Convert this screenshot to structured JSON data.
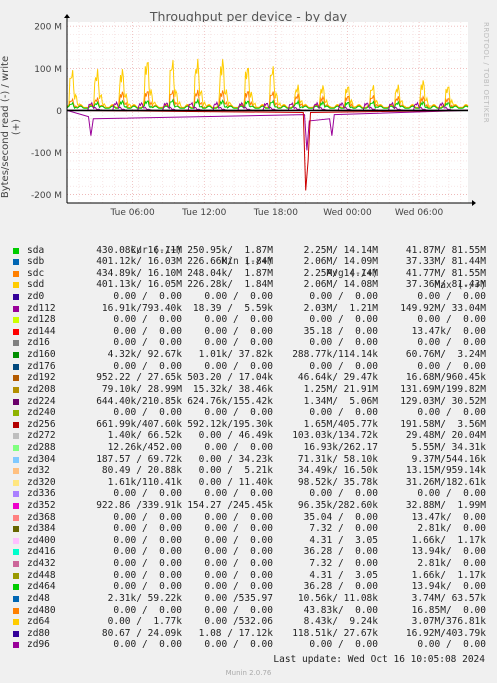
{
  "title": "Throughput per device - by day",
  "ylabel": "Bytes/second read (-) / write (+)",
  "watermark": "RRDTOOL / TOBI OETIKER",
  "chart_data": {
    "type": "line",
    "title": "Throughput per device - by day",
    "ylabel": "Bytes/second read (-) / write (+)",
    "ylim": [
      -220,
      210
    ],
    "y_ticks": [
      {
        "value": 200,
        "label": "200 M"
      },
      {
        "value": 100,
        "label": "100 M"
      },
      {
        "value": 0,
        "label": "0"
      },
      {
        "value": -100,
        "label": "-100 M"
      },
      {
        "value": -200,
        "label": "-200 M"
      }
    ],
    "x_range_hours": [
      0,
      33.6
    ],
    "x_ticks": [
      {
        "hour": 5.5,
        "label": "Tue 06:00"
      },
      {
        "hour": 11.5,
        "label": "Tue 12:00"
      },
      {
        "hour": 17.5,
        "label": "Tue 18:00"
      },
      {
        "hour": 23.5,
        "label": "Wed 00:00"
      },
      {
        "hour": 29.5,
        "label": "Wed 06:00"
      }
    ],
    "grid": true,
    "series": [
      {
        "name": "sdd",
        "color": "#ffcc00",
        "kind": "spike",
        "peaks": [
          0.2,
          2.3,
          4.4,
          6.5,
          8.6,
          10.7,
          12.8,
          14.9,
          17.0,
          19.1,
          21.2,
          23.3,
          25.4,
          27.5,
          29.6,
          31.7
        ],
        "heights": [
          160,
          160,
          165,
          205,
          200,
          200,
          205,
          180,
          175,
          100,
          100,
          100,
          100,
          100,
          120,
          100
        ],
        "base": 14
      },
      {
        "name": "sdc",
        "color": "#ff8000",
        "kind": "spike",
        "peaks": [
          0.2,
          2.3,
          4.4,
          6.5,
          8.6,
          10.7,
          12.8,
          14.9,
          17.0,
          19.1,
          21.2,
          23.3,
          25.4,
          27.5,
          29.6,
          31.7
        ],
        "heights": [
          45,
          50,
          75,
          80,
          80,
          80,
          80,
          80,
          75,
          65,
          55,
          60,
          60,
          55,
          55,
          50
        ],
        "base": 12
      },
      {
        "name": "sda",
        "color": "#00cc00",
        "kind": "spike",
        "peaks": [
          0.2,
          2.3,
          4.4,
          6.5,
          8.6,
          10.7,
          12.8,
          14.9,
          17.0,
          19.1,
          21.2,
          23.3,
          25.4,
          27.5,
          29.6,
          31.7
        ],
        "heights": [
          30,
          32,
          38,
          40,
          42,
          41,
          40,
          39,
          38,
          36,
          34,
          34,
          35,
          33,
          34,
          32
        ],
        "base": 10
      },
      {
        "name": "zd112",
        "color": "#990099",
        "kind": "spike",
        "peaks": [
          1.8,
          3.9,
          6.0,
          8.1,
          10.2,
          12.3,
          14.4,
          16.5,
          18.6,
          20.7,
          22.8,
          24.9,
          27.0,
          29.1,
          31.2
        ],
        "heights": [
          30,
          32,
          30,
          31,
          30,
          31,
          30,
          30,
          29,
          30,
          30,
          31,
          30,
          30,
          30
        ],
        "base": 0
      },
      {
        "name": "read",
        "color": "#990099",
        "kind": "neg",
        "points": [
          [
            1.8,
            -15
          ],
          [
            2.0,
            -60
          ],
          [
            2.2,
            -20
          ],
          [
            19.9,
            -10
          ],
          [
            20.1,
            -95
          ],
          [
            20.3,
            -25
          ],
          [
            22.0,
            -20
          ],
          [
            22.2,
            -60
          ],
          [
            22.4,
            -10
          ]
        ]
      },
      {
        "name": "zd176",
        "color": "#cc0000",
        "kind": "neg",
        "points": [
          [
            19.8,
            -5
          ],
          [
            20.0,
            -190
          ],
          [
            20.2,
            -120
          ],
          [
            20.4,
            -5
          ]
        ]
      }
    ]
  },
  "legend": {
    "headers": {
      "cur": "Cur (-/+)",
      "min": "Min (-/+)",
      "avg": "Avg (-/+)",
      "max": "Max (-/+)"
    },
    "rows": [
      {
        "name": "sda",
        "color": "#00cc00",
        "cur": "430.08k/ 16.11M",
        "min": "250.95k/  1.87M",
        "avg": "2.25M/ 14.14M",
        "max": "41.87M/ 81.55M"
      },
      {
        "name": "sdb",
        "color": "#0066b3",
        "cur": "401.12k/ 16.03M",
        "min": "226.66k/  1.84M",
        "avg": "2.06M/ 14.09M",
        "max": "37.33M/ 81.44M"
      },
      {
        "name": "sdc",
        "color": "#ff8000",
        "cur": "434.89k/ 16.10M",
        "min": "248.04k/  1.87M",
        "avg": "2.25M/ 14.14M",
        "max": "41.77M/ 81.55M"
      },
      {
        "name": "sdd",
        "color": "#ffcc00",
        "cur": "401.13k/ 16.05M",
        "min": "226.28k/  1.84M",
        "avg": "2.06M/ 14.08M",
        "max": "37.36M/ 81.43M"
      },
      {
        "name": "zd0",
        "color": "#330099",
        "cur": "0.00 /  0.00",
        "min": "0.00 /  0.00",
        "avg": "0.00 /  0.00",
        "max": "0.00 /  0.00"
      },
      {
        "name": "zd112",
        "color": "#990099",
        "cur": "16.91k/793.40k",
        "min": "18.39 /  5.59k",
        "avg": "2.03M/  1.21M",
        "max": "149.92M/ 33.04M"
      },
      {
        "name": "zd128",
        "color": "#ccff00",
        "cur": "0.00 /  0.00",
        "min": "0.00 /  0.00",
        "avg": "0.00 /  0.00",
        "max": "0.00 /  0.00"
      },
      {
        "name": "zd144",
        "color": "#ff0000",
        "cur": "0.00 /  0.00",
        "min": "0.00 /  0.00",
        "avg": "35.18 /  0.00",
        "max": "13.47k/  0.00"
      },
      {
        "name": "zd16",
        "color": "#808080",
        "cur": "0.00 /  0.00",
        "min": "0.00 /  0.00",
        "avg": "0.00 /  0.00",
        "max": "0.00 /  0.00"
      },
      {
        "name": "zd160",
        "color": "#008f00",
        "cur": "4.32k/ 92.67k",
        "min": "1.01k/ 37.82k",
        "avg": "288.77k/114.14k",
        "max": "60.76M/  3.24M"
      },
      {
        "name": "zd176",
        "color": "#00487d",
        "cur": "0.00 /  0.00",
        "min": "0.00 /  0.00",
        "avg": "0.00 /  0.00",
        "max": "0.00 /  0.00"
      },
      {
        "name": "zd192",
        "color": "#b35a00",
        "cur": "952.22 / 27.65k",
        "min": "503.20 / 17.04k",
        "avg": "46.64k/ 29.47k",
        "max": "16.68M/960.45k"
      },
      {
        "name": "zd208",
        "color": "#b38f00",
        "cur": "79.10k/ 28.99M",
        "min": "15.32k/ 38.46k",
        "avg": "1.25M/ 21.91M",
        "max": "131.69M/199.82M"
      },
      {
        "name": "zd224",
        "color": "#6b006b",
        "cur": "644.40k/210.85k",
        "min": "624.76k/155.42k",
        "avg": "1.34M/  5.06M",
        "max": "129.03M/ 30.52M"
      },
      {
        "name": "zd240",
        "color": "#8fb300",
        "cur": "0.00 /  0.00",
        "min": "0.00 /  0.00",
        "avg": "0.00 /  0.00",
        "max": "0.00 /  0.00"
      },
      {
        "name": "zd256",
        "color": "#b30000",
        "cur": "661.99k/407.60k",
        "min": "592.12k/195.30k",
        "avg": "1.65M/405.77k",
        "max": "191.58M/  3.56M"
      },
      {
        "name": "zd272",
        "color": "#bebebe",
        "cur": "1.40k/ 66.52k",
        "min": "0.00 / 46.49k",
        "avg": "103.03k/134.72k",
        "max": "29.48M/ 20.04M"
      },
      {
        "name": "zd288",
        "color": "#80ff80",
        "cur": "12.26k/452.00",
        "min": "0.00 /  0.00",
        "avg": "16.93k/262.17",
        "max": "5.55M/ 34.31k"
      },
      {
        "name": "zd304",
        "color": "#80c9ff",
        "cur": "187.57 / 69.72k",
        "min": "0.00 / 34.23k",
        "avg": "71.31k/ 58.10k",
        "max": "9.37M/544.16k"
      },
      {
        "name": "zd32",
        "color": "#ffc080",
        "cur": "80.49 / 20.88k",
        "min": "0.00 /  5.21k",
        "avg": "34.49k/ 16.50k",
        "max": "13.15M/959.14k"
      },
      {
        "name": "zd320",
        "color": "#ffe680",
        "cur": "1.61k/110.41k",
        "min": "0.00 / 11.40k",
        "avg": "98.52k/ 35.78k",
        "max": "31.26M/182.61k"
      },
      {
        "name": "zd336",
        "color": "#aa80ff",
        "cur": "0.00 /  0.00",
        "min": "0.00 /  0.00",
        "avg": "0.00 /  0.00",
        "max": "0.00 /  0.00"
      },
      {
        "name": "zd352",
        "color": "#ee00cc",
        "cur": "922.86 /339.91k",
        "min": "154.27 /245.45k",
        "avg": "96.35k/282.60k",
        "max": "32.88M/  1.99M"
      },
      {
        "name": "zd368",
        "color": "#ff8080",
        "cur": "0.00 /  0.00",
        "min": "0.00 /  0.00",
        "avg": "35.04 /  0.00",
        "max": "13.47k/  0.00"
      },
      {
        "name": "zd384",
        "color": "#666600",
        "cur": "0.00 /  0.00",
        "min": "0.00 /  0.00",
        "avg": "7.32 /  0.00",
        "max": "2.81k/  0.00"
      },
      {
        "name": "zd400",
        "color": "#ffbfff",
        "cur": "0.00 /  0.00",
        "min": "0.00 /  0.00",
        "avg": "4.31 /  3.05",
        "max": "1.66k/  1.17k"
      },
      {
        "name": "zd416",
        "color": "#00ffcc",
        "cur": "0.00 /  0.00",
        "min": "0.00 /  0.00",
        "avg": "36.28 /  0.00",
        "max": "13.94k/  0.00"
      },
      {
        "name": "zd432",
        "color": "#cc6699",
        "cur": "0.00 /  0.00",
        "min": "0.00 /  0.00",
        "avg": "7.32 /  0.00",
        "max": "2.81k/  0.00"
      },
      {
        "name": "zd448",
        "color": "#999900",
        "cur": "0.00 /  0.00",
        "min": "0.00 /  0.00",
        "avg": "4.31 /  3.05",
        "max": "1.66k/  1.17k"
      },
      {
        "name": "zd464",
        "color": "#00cc00",
        "cur": "0.00 /  0.00",
        "min": "0.00 /  0.00",
        "avg": "36.28 /  0.00",
        "max": "13.94k/  0.00"
      },
      {
        "name": "zd48",
        "color": "#0066b3",
        "cur": "2.31k/ 59.22k",
        "min": "0.00 /535.97",
        "avg": "10.56k/ 11.08k",
        "max": "3.74M/ 63.57k"
      },
      {
        "name": "zd480",
        "color": "#ff8000",
        "cur": "0.00 /  0.00",
        "min": "0.00 /  0.00",
        "avg": "43.83k/  0.00",
        "max": "16.85M/  0.00"
      },
      {
        "name": "zd64",
        "color": "#ffcc00",
        "cur": "0.00 /  1.77k",
        "min": "0.00 /532.06",
        "avg": "8.43k/  9.24k",
        "max": "3.07M/376.81k"
      },
      {
        "name": "zd80",
        "color": "#330099",
        "cur": "80.67 / 24.09k",
        "min": "1.08 / 17.12k",
        "avg": "118.51k/ 27.67k",
        "max": "16.92M/403.79k"
      },
      {
        "name": "zd96",
        "color": "#990099",
        "cur": "0.00 /  0.00",
        "min": "0.00 /  0.00",
        "avg": "0.00 /  0.00",
        "max": "0.00 /  0.00"
      }
    ]
  },
  "last_update": "Last update:  Wed Oct 16 10:05:08 2024",
  "version": "Munin 2.0.76"
}
